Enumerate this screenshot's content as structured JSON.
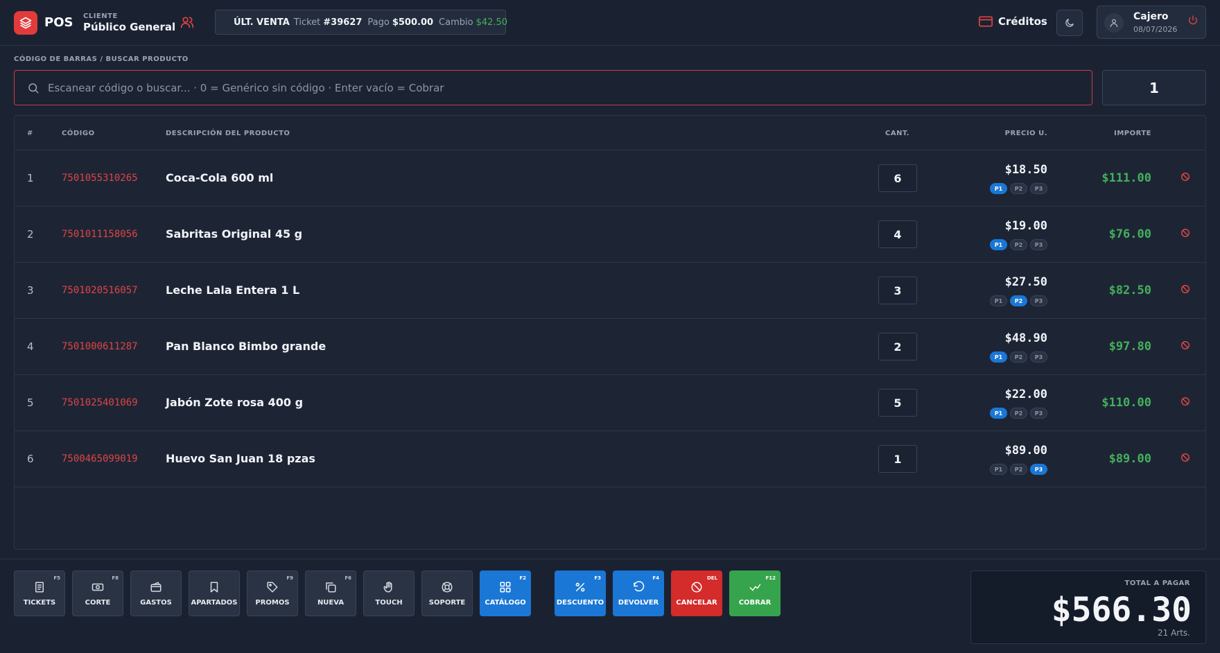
{
  "header": {
    "app_name": "POS",
    "client_label": "CLIENTE",
    "client_name": "Público General",
    "last_sale": {
      "label": "ÚLT. VENTA",
      "ticket_label": "Ticket",
      "ticket_number": "#39627",
      "payment_label": "Pago",
      "payment_value": "$500.00",
      "change_label": "Cambio",
      "change_value": "$42.50"
    },
    "credits_label": "Créditos",
    "user_name": "Cajero",
    "user_date": "08/07/2026"
  },
  "search": {
    "label": "CÓDIGO DE BARRAS / BUSCAR PRODUCTO",
    "placeholder": "Escanear código o buscar... · 0 = Genérico sin código · Enter vacío = Cobrar",
    "quantity": "1"
  },
  "table": {
    "headers": {
      "num": "#",
      "code": "CÓDIGO",
      "desc": "DESCRIPCIÓN DEL PRODUCTO",
      "qty": "CANT.",
      "price": "PRECIO U.",
      "amount": "IMPORTE"
    },
    "tier_labels": [
      "P1",
      "P2",
      "P3"
    ],
    "rows": [
      {
        "num": "1",
        "code": "7501055310265",
        "desc": "Coca-Cola 600 ml",
        "qty": "6",
        "price": "$18.50",
        "tier": 0,
        "amount": "$111.00"
      },
      {
        "num": "2",
        "code": "7501011158056",
        "desc": "Sabritas Original 45 g",
        "qty": "4",
        "price": "$19.00",
        "tier": 0,
        "amount": "$76.00"
      },
      {
        "num": "3",
        "code": "7501020516057",
        "desc": "Leche Lala Entera 1 L",
        "qty": "3",
        "price": "$27.50",
        "tier": 1,
        "amount": "$82.50"
      },
      {
        "num": "4",
        "code": "7501000611287",
        "desc": "Pan Blanco Bimbo grande",
        "qty": "2",
        "price": "$48.90",
        "tier": 0,
        "amount": "$97.80"
      },
      {
        "num": "5",
        "code": "7501025401069",
        "desc": "Jabón Zote rosa 400 g",
        "qty": "5",
        "price": "$22.00",
        "tier": 0,
        "amount": "$110.00"
      },
      {
        "num": "6",
        "code": "7500465099019",
        "desc": "Huevo San Juan 18 pzas",
        "qty": "1",
        "price": "$89.00",
        "tier": 2,
        "amount": "$89.00"
      }
    ]
  },
  "footer": {
    "buttons": [
      {
        "label": "TICKETS",
        "key": "F5",
        "icon": "receipt-icon",
        "style": ""
      },
      {
        "label": "CORTE",
        "key": "F8",
        "icon": "cash-icon",
        "style": ""
      },
      {
        "label": "GASTOS",
        "key": "",
        "icon": "wallet-icon",
        "style": ""
      },
      {
        "label": "APARTADOS",
        "key": "",
        "icon": "bookmark-icon",
        "style": ""
      },
      {
        "label": "PROMOS",
        "key": "F9",
        "icon": "tag-icon",
        "style": ""
      },
      {
        "label": "NUEVA",
        "key": "F6",
        "icon": "copy-icon",
        "style": ""
      },
      {
        "label": "TOUCH",
        "key": "",
        "icon": "hand-icon",
        "style": ""
      },
      {
        "label": "SOPORTE",
        "key": "",
        "icon": "lifebuoy-icon",
        "style": ""
      },
      {
        "label": "CATÁLOGO",
        "key": "F2",
        "icon": "grid-icon",
        "style": "blue"
      },
      {
        "label": "DESCUENTO",
        "key": "F3",
        "icon": "percent-icon",
        "style": "blue"
      },
      {
        "label": "DEVOLVER",
        "key": "F4",
        "icon": "undo-icon",
        "style": "blue"
      },
      {
        "label": "CANCELAR",
        "key": "DEL",
        "icon": "ban-icon",
        "style": "red"
      },
      {
        "label": "COBRAR",
        "key": "F12",
        "icon": "check-icon",
        "style": "green"
      }
    ],
    "total_label": "TOTAL A PAGAR",
    "total_value": "$566.30",
    "total_items": "21 Arts."
  },
  "colors": {
    "accent_red": "#e23b3b",
    "accent_blue": "#1a77d6",
    "accent_green": "#44b05a",
    "background": "#1b2333"
  }
}
